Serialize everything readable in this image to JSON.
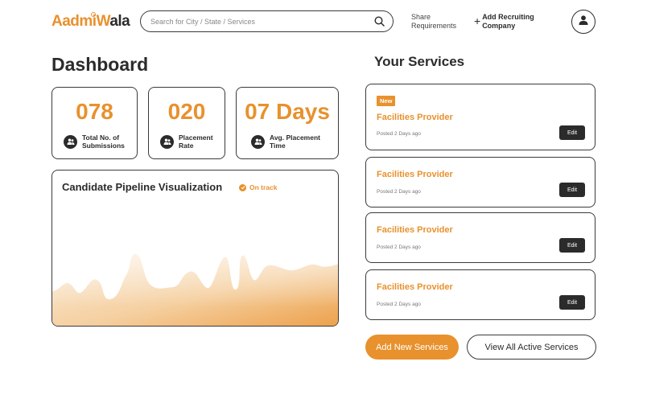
{
  "header": {
    "logo": {
      "part1": "Aadmi",
      "part2": "W",
      "part3": "ala"
    },
    "search_placeholder": "Search for City / State / Services",
    "share_label": "Share Requirements",
    "add_label": "Add Recruiting Company"
  },
  "dashboard": {
    "title": "Dashboard",
    "stats": [
      {
        "value": "078",
        "label": "Total No. of Submissions"
      },
      {
        "value": "020",
        "label": "Placement Rate"
      },
      {
        "value": "07 Days",
        "label": "Avg. Placement Time"
      }
    ],
    "pipeline": {
      "title": "Candidate Pipeline Visualization",
      "status": "On track"
    }
  },
  "services": {
    "title": "Your Services",
    "items": [
      {
        "badge": "New",
        "name": "Facilities Provider",
        "posted": "Posted 2 Days ago",
        "edit": "Edit"
      },
      {
        "badge": "",
        "name": "Facilities Provider",
        "posted": "Posted 2 Days ago",
        "edit": "Edit"
      },
      {
        "badge": "",
        "name": "Facilities Provider",
        "posted": "Posted 2 Days ago",
        "edit": "Edit"
      },
      {
        "badge": "",
        "name": "Facilities Provider",
        "posted": "Posted 2 Days ago",
        "edit": "Edit"
      }
    ],
    "add_button": "Add New Services",
    "view_button": "View All Active Services"
  },
  "colors": {
    "accent": "#e8912d",
    "dark": "#2b2b2b"
  },
  "icons": [
    "search-icon",
    "plus-icon",
    "user-icon",
    "people-icon",
    "check-icon"
  ]
}
